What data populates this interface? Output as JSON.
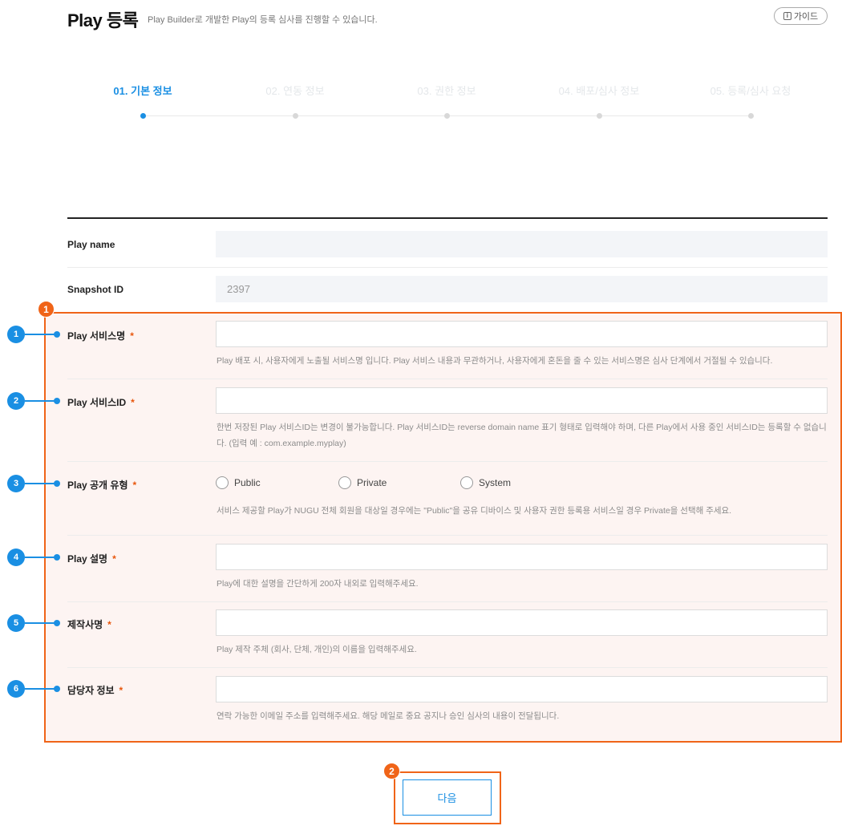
{
  "header": {
    "title": "Play 등록",
    "subtitle": "Play Builder로 개발한 Play의 등록 심사를 진행할 수 있습니다.",
    "guide_label": "가이드",
    "guide_icon": "info-icon"
  },
  "steps": [
    {
      "label": "01. 기본 정보",
      "active": true
    },
    {
      "label": "02. 연동 정보",
      "active": false
    },
    {
      "label": "03. 권한 정보",
      "active": false
    },
    {
      "label": "04. 배포/심사 정보",
      "active": false
    },
    {
      "label": "05. 등록/심사 요청",
      "active": false
    }
  ],
  "form": {
    "play_name": {
      "label": "Play name",
      "value": ""
    },
    "snapshot_id": {
      "label": "Snapshot ID",
      "value": "2397"
    },
    "service_name": {
      "label": "Play 서비스명",
      "help": "Play 배포 시, 사용자에게 노출될 서비스명 입니다. Play 서비스 내용과 무관하거나, 사용자에게 혼돈을 줄 수 있는 서비스명은 심사 단계에서 거절될 수 있습니다."
    },
    "service_id": {
      "label": "Play 서비스ID",
      "help": "한번 저장된 Play 서비스ID는 변경이 불가능합니다. Play 서비스ID는 reverse domain name 표기 형태로 입력해야 하며, 다른 Play에서 사용 중인 서비스ID는 등록할 수 없습니다. (입력 예 : com.example.myplay)"
    },
    "visibility": {
      "label": "Play 공개 유형",
      "options": [
        "Public",
        "Private",
        "System"
      ],
      "help": "서비스 제공할 Play가 NUGU 전체 회원을 대상일 경우에는 \"Public\"을 공유 디바이스 및 사용자 권한 등록용 서비스일 경우 Private을 선택해 주세요."
    },
    "description": {
      "label": "Play 설명",
      "help": "Play에 대한 설명을 간단하게 200자 내외로 입력해주세요."
    },
    "producer": {
      "label": "제작사명",
      "help": "Play 제작 주체 (회사, 단체, 개인)의 이름을 입력해주세요."
    },
    "contact": {
      "label": "담당자 정보",
      "help": "연락 가능한 이메일 주소를 입력해주세요. 해당 메일로 중요 공지나 승인 심사의 내용이 전달됩니다."
    },
    "required_mark": "*"
  },
  "annotations": {
    "region_badge": "1",
    "button_badge": "2",
    "field_badges": [
      "1",
      "2",
      "3",
      "4",
      "5",
      "6"
    ],
    "highlight_color": "#f06418",
    "marker_color": "#1a8fe3"
  },
  "next_button": "다음"
}
